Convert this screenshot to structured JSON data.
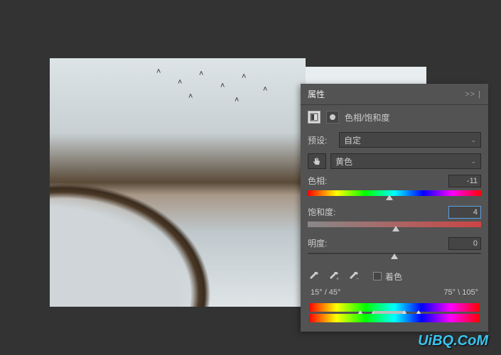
{
  "panel": {
    "title": "属性",
    "collapse": ">> |",
    "adjustment_name": "色相/饱和度",
    "preset_label": "预设:",
    "preset_value": "自定",
    "channel_value": "黄色",
    "hue": {
      "label": "色相:",
      "value": "-11",
      "pos": 47
    },
    "saturation": {
      "label": "饱和度:",
      "value": "4",
      "pos": 51
    },
    "lightness": {
      "label": "明度:",
      "value": "0",
      "pos": 50
    },
    "colorize_label": "着色",
    "range_left": "15° / 45°",
    "range_right": "75° \\ 105°"
  },
  "watermark": "UiBQ.CoM"
}
